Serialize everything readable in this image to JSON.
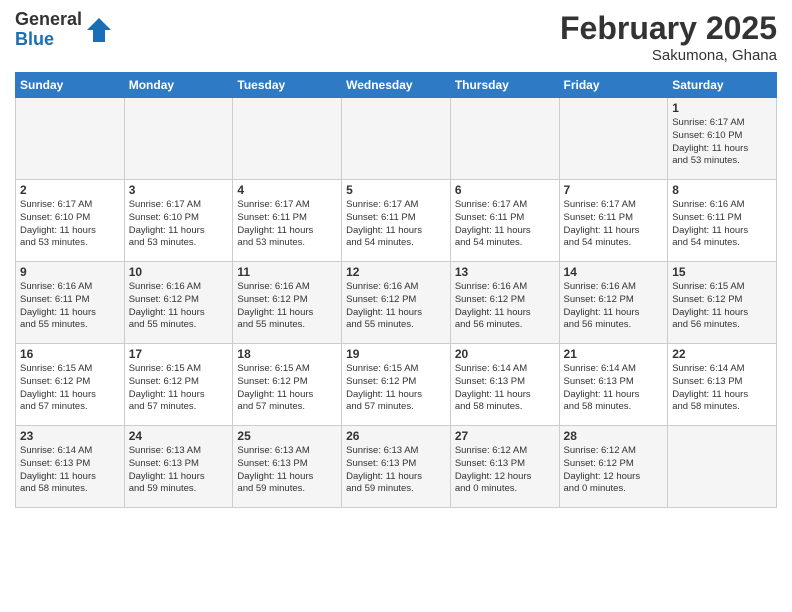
{
  "header": {
    "logo_general": "General",
    "logo_blue": "Blue",
    "month_title": "February 2025",
    "subtitle": "Sakumona, Ghana"
  },
  "days_of_week": [
    "Sunday",
    "Monday",
    "Tuesday",
    "Wednesday",
    "Thursday",
    "Friday",
    "Saturday"
  ],
  "weeks": [
    {
      "days": [
        {
          "num": "",
          "info": ""
        },
        {
          "num": "",
          "info": ""
        },
        {
          "num": "",
          "info": ""
        },
        {
          "num": "",
          "info": ""
        },
        {
          "num": "",
          "info": ""
        },
        {
          "num": "",
          "info": ""
        },
        {
          "num": "1",
          "info": "Sunrise: 6:17 AM\nSunset: 6:10 PM\nDaylight: 11 hours\nand 53 minutes."
        }
      ]
    },
    {
      "days": [
        {
          "num": "2",
          "info": "Sunrise: 6:17 AM\nSunset: 6:10 PM\nDaylight: 11 hours\nand 53 minutes."
        },
        {
          "num": "3",
          "info": "Sunrise: 6:17 AM\nSunset: 6:10 PM\nDaylight: 11 hours\nand 53 minutes."
        },
        {
          "num": "4",
          "info": "Sunrise: 6:17 AM\nSunset: 6:11 PM\nDaylight: 11 hours\nand 53 minutes."
        },
        {
          "num": "5",
          "info": "Sunrise: 6:17 AM\nSunset: 6:11 PM\nDaylight: 11 hours\nand 54 minutes."
        },
        {
          "num": "6",
          "info": "Sunrise: 6:17 AM\nSunset: 6:11 PM\nDaylight: 11 hours\nand 54 minutes."
        },
        {
          "num": "7",
          "info": "Sunrise: 6:17 AM\nSunset: 6:11 PM\nDaylight: 11 hours\nand 54 minutes."
        },
        {
          "num": "8",
          "info": "Sunrise: 6:16 AM\nSunset: 6:11 PM\nDaylight: 11 hours\nand 54 minutes."
        }
      ]
    },
    {
      "days": [
        {
          "num": "9",
          "info": "Sunrise: 6:16 AM\nSunset: 6:11 PM\nDaylight: 11 hours\nand 55 minutes."
        },
        {
          "num": "10",
          "info": "Sunrise: 6:16 AM\nSunset: 6:12 PM\nDaylight: 11 hours\nand 55 minutes."
        },
        {
          "num": "11",
          "info": "Sunrise: 6:16 AM\nSunset: 6:12 PM\nDaylight: 11 hours\nand 55 minutes."
        },
        {
          "num": "12",
          "info": "Sunrise: 6:16 AM\nSunset: 6:12 PM\nDaylight: 11 hours\nand 55 minutes."
        },
        {
          "num": "13",
          "info": "Sunrise: 6:16 AM\nSunset: 6:12 PM\nDaylight: 11 hours\nand 56 minutes."
        },
        {
          "num": "14",
          "info": "Sunrise: 6:16 AM\nSunset: 6:12 PM\nDaylight: 11 hours\nand 56 minutes."
        },
        {
          "num": "15",
          "info": "Sunrise: 6:15 AM\nSunset: 6:12 PM\nDaylight: 11 hours\nand 56 minutes."
        }
      ]
    },
    {
      "days": [
        {
          "num": "16",
          "info": "Sunrise: 6:15 AM\nSunset: 6:12 PM\nDaylight: 11 hours\nand 57 minutes."
        },
        {
          "num": "17",
          "info": "Sunrise: 6:15 AM\nSunset: 6:12 PM\nDaylight: 11 hours\nand 57 minutes."
        },
        {
          "num": "18",
          "info": "Sunrise: 6:15 AM\nSunset: 6:12 PM\nDaylight: 11 hours\nand 57 minutes."
        },
        {
          "num": "19",
          "info": "Sunrise: 6:15 AM\nSunset: 6:12 PM\nDaylight: 11 hours\nand 57 minutes."
        },
        {
          "num": "20",
          "info": "Sunrise: 6:14 AM\nSunset: 6:13 PM\nDaylight: 11 hours\nand 58 minutes."
        },
        {
          "num": "21",
          "info": "Sunrise: 6:14 AM\nSunset: 6:13 PM\nDaylight: 11 hours\nand 58 minutes."
        },
        {
          "num": "22",
          "info": "Sunrise: 6:14 AM\nSunset: 6:13 PM\nDaylight: 11 hours\nand 58 minutes."
        }
      ]
    },
    {
      "days": [
        {
          "num": "23",
          "info": "Sunrise: 6:14 AM\nSunset: 6:13 PM\nDaylight: 11 hours\nand 58 minutes."
        },
        {
          "num": "24",
          "info": "Sunrise: 6:13 AM\nSunset: 6:13 PM\nDaylight: 11 hours\nand 59 minutes."
        },
        {
          "num": "25",
          "info": "Sunrise: 6:13 AM\nSunset: 6:13 PM\nDaylight: 11 hours\nand 59 minutes."
        },
        {
          "num": "26",
          "info": "Sunrise: 6:13 AM\nSunset: 6:13 PM\nDaylight: 11 hours\nand 59 minutes."
        },
        {
          "num": "27",
          "info": "Sunrise: 6:12 AM\nSunset: 6:13 PM\nDaylight: 12 hours\nand 0 minutes."
        },
        {
          "num": "28",
          "info": "Sunrise: 6:12 AM\nSunset: 6:12 PM\nDaylight: 12 hours\nand 0 minutes."
        },
        {
          "num": "",
          "info": ""
        }
      ]
    }
  ]
}
